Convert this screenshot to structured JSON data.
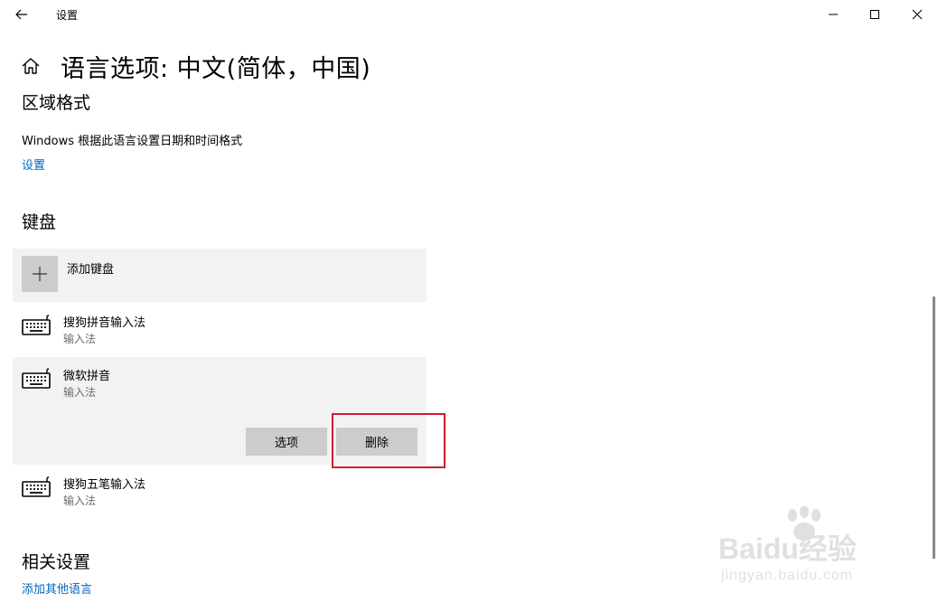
{
  "window": {
    "app_title": "设置",
    "controls": [
      "back-arrow-icon",
      "minimize-icon",
      "maximize-icon",
      "close-icon"
    ]
  },
  "page": {
    "title": "语言选项: 中文(简体，中国)",
    "home_icon": "home-icon"
  },
  "region": {
    "heading": "区域格式",
    "description": "Windows 根据此语言设置日期和时间格式",
    "settings_link": "设置"
  },
  "keyboard": {
    "heading": "键盘",
    "add_label": "添加键盘",
    "items": [
      {
        "name": "搜狗拼音输入法",
        "type": "输入法",
        "icon": "keyboard-icon"
      },
      {
        "name": "微软拼音",
        "type": "输入法",
        "icon": "keyboard-icon",
        "expanded": true,
        "buttons": {
          "options": "选项",
          "delete": "删除"
        }
      },
      {
        "name": "搜狗五笔输入法",
        "type": "输入法",
        "icon": "keyboard-icon"
      }
    ]
  },
  "related": {
    "heading": "相关设置",
    "add_language_link": "添加其他语言"
  },
  "watermark": {
    "main": "Baidu经验",
    "sub": "jingyan.baidu.com"
  },
  "colors": {
    "accent_link": "#0067c0",
    "tile_background": "#f2f2f2",
    "button_background": "#cccccc",
    "highlight": "#cc1f2b"
  }
}
